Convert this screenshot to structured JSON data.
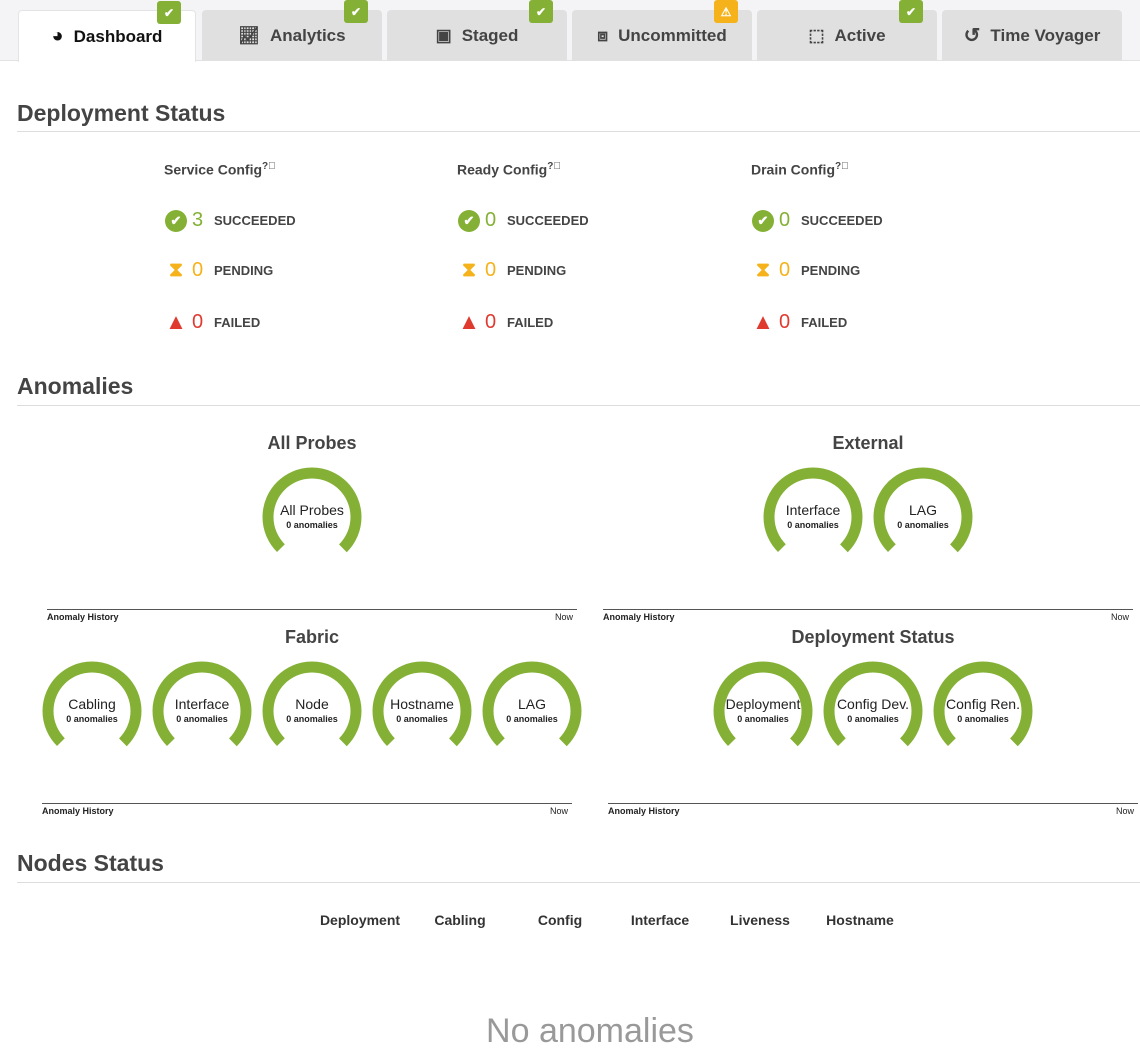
{
  "tabs": [
    {
      "label": "Dashboard",
      "icon": "dashboard-gauge-icon",
      "badge": "ok"
    },
    {
      "label": "Analytics",
      "icon": "chart-line-icon",
      "badge": "ok"
    },
    {
      "label": "Staged",
      "icon": "staged-box-icon",
      "badge": "ok"
    },
    {
      "label": "Uncommitted",
      "icon": "cubes-icon",
      "badge": "warning"
    },
    {
      "label": "Active",
      "icon": "active-cube-icon",
      "badge": "ok"
    },
    {
      "label": "Time Voyager",
      "icon": "history-icon",
      "badge": null
    }
  ],
  "deployment_status": {
    "title": "Deployment Status",
    "columns": [
      {
        "title": "Service Config",
        "succeeded": "3",
        "pending": "0",
        "failed": "0"
      },
      {
        "title": "Ready Config",
        "succeeded": "0",
        "pending": "0",
        "failed": "0"
      },
      {
        "title": "Drain Config",
        "succeeded": "0",
        "pending": "0",
        "failed": "0"
      }
    ],
    "labels": {
      "succeeded": "SUCCEEDED",
      "pending": "PENDING",
      "failed": "FAILED"
    }
  },
  "anomalies": {
    "title": "Anomalies",
    "history_label": "Anomaly History",
    "now_label": "Now",
    "panels": [
      {
        "title": "All Probes",
        "gauges": [
          {
            "label": "All Probes",
            "sub": "0 anomalies"
          }
        ]
      },
      {
        "title": "External",
        "gauges": [
          {
            "label": "Interface",
            "sub": "0 anomalies"
          },
          {
            "label": "LAG",
            "sub": "0 anomalies"
          }
        ]
      },
      {
        "title": "Fabric",
        "gauges": [
          {
            "label": "Cabling",
            "sub": "0 anomalies"
          },
          {
            "label": "Interface",
            "sub": "0 anomalies"
          },
          {
            "label": "Node",
            "sub": "0 anomalies"
          },
          {
            "label": "Hostname",
            "sub": "0 anomalies"
          },
          {
            "label": "LAG",
            "sub": "0 anomalies"
          }
        ]
      },
      {
        "title": "Deployment Status",
        "gauges": [
          {
            "label": "Deployment",
            "sub": "0 anomalies"
          },
          {
            "label": "Config Dev.",
            "sub": "0 anomalies"
          },
          {
            "label": "Config Ren.",
            "sub": "0 anomalies"
          }
        ]
      }
    ]
  },
  "nodes_status": {
    "title": "Nodes Status",
    "columns": [
      "Deployment",
      "Cabling",
      "Config",
      "Interface",
      "Liveness",
      "Hostname"
    ],
    "empty": "No anomalies"
  },
  "colors": {
    "ok": "#84b135",
    "warn": "#f5b21b",
    "fail": "#e03a2f"
  }
}
